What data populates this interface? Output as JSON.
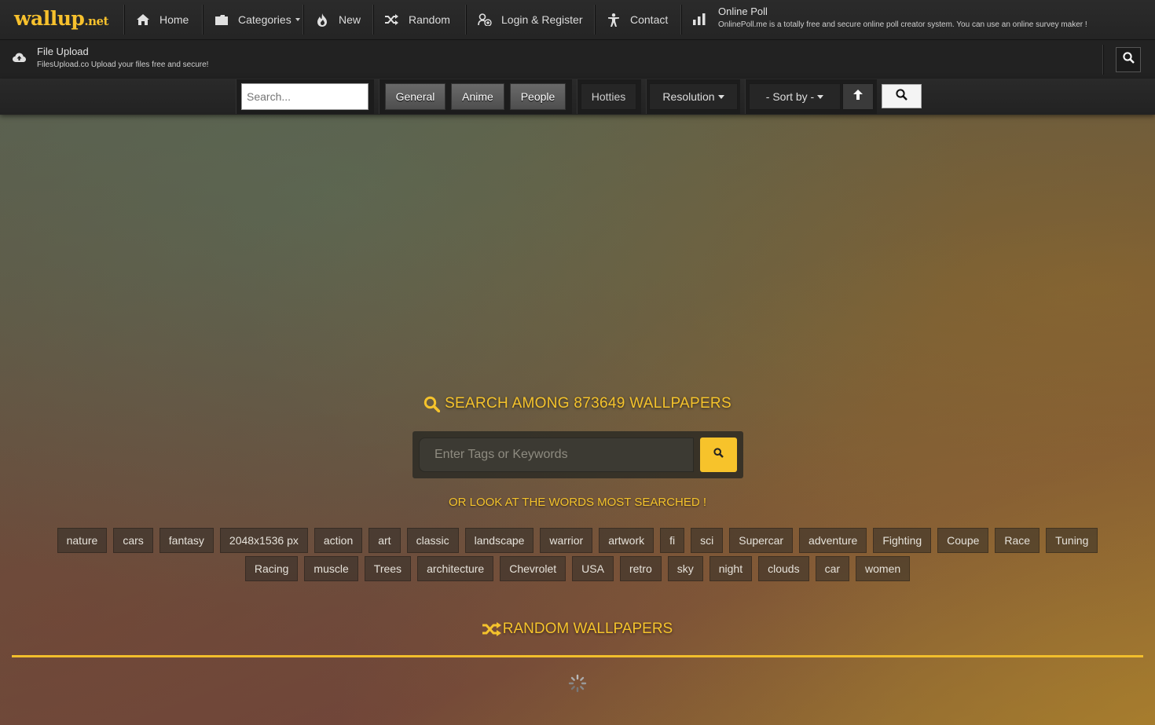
{
  "logo": {
    "main": "wallup",
    "tld": ".net"
  },
  "nav": {
    "home": "Home",
    "categories": "Categories",
    "new": "New",
    "random": "Random",
    "login": "Login & Register",
    "contact": "Contact",
    "poll_title": "Online Poll",
    "poll_desc": "OnlinePoll.me is a totally free and secure online poll creator system. You can use an online survey maker !",
    "upload_title": "File Upload",
    "upload_desc": "FilesUpload.co Upload your files free and secure!"
  },
  "filters": {
    "search_placeholder": "Search...",
    "general": "General",
    "anime": "Anime",
    "people": "People",
    "hotties": "Hotties",
    "resolution": "Resolution",
    "sort_by": "- Sort by -"
  },
  "main": {
    "headline": "SEARCH AMONG 873649 WALLPAPERS",
    "search_placeholder": "Enter Tags or Keywords",
    "subhead": "OR LOOK AT THE WORDS MOST SEARCHED !",
    "random_head": "RANDOM WALLPAPERS"
  },
  "tags": [
    "nature",
    "cars",
    "fantasy",
    "2048x1536 px",
    "action",
    "art",
    "classic",
    "landscape",
    "warrior",
    "artwork",
    "fi",
    "sci",
    "Supercar",
    "adventure",
    "Fighting",
    "Coupe",
    "Race",
    "Tuning",
    "Racing",
    "muscle",
    "Trees",
    "architecture",
    "Chevrolet",
    "USA",
    "retro",
    "sky",
    "night",
    "clouds",
    "car",
    "women"
  ],
  "colors": {
    "accent": "#f5c32c",
    "nav_bg": "#262626"
  }
}
